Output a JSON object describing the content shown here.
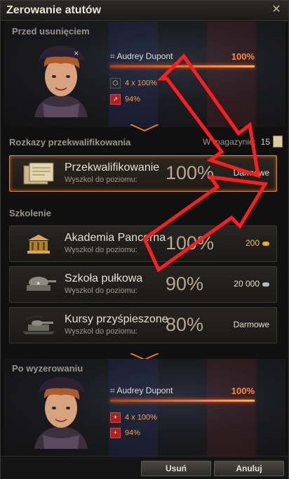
{
  "window": {
    "title": "Zerowanie atutów"
  },
  "before": {
    "label": "Przed usunięciem",
    "crew_name": "Audrey Dupont",
    "percent": "100%",
    "progress": 1.0,
    "skills": [
      {
        "icon": "perk-icon",
        "text": "4 x 100%"
      },
      {
        "icon": "perk-icon",
        "text": "94%"
      }
    ]
  },
  "orders": {
    "header": "Rozkazy przekwalifikowania",
    "storage_label": "W magazynie:",
    "storage_count": "15",
    "item": {
      "name": "Przekwalifikowanie",
      "sub": "Wyszkol do poziomu:",
      "percent": "100%",
      "price": "Darmowe"
    }
  },
  "training": {
    "header": "Szkolenie",
    "options": [
      {
        "name": "Akademia Pancerna",
        "sub": "Wyszkol do poziomu:",
        "percent": "100%",
        "price": "200",
        "currency": "gold"
      },
      {
        "name": "Szkoła pułkowa",
        "sub": "Wyszkol do poziomu:",
        "percent": "90%",
        "price": "20 000",
        "currency": "silver"
      },
      {
        "name": "Kursy przyśpieszone",
        "sub": "Wyszkol do poziomu:",
        "percent": "80%",
        "price": "Darmowe",
        "currency": "none"
      }
    ]
  },
  "after": {
    "label": "Po wyzerowaniu",
    "crew_name": "Audrey Dupont",
    "percent": "100%",
    "progress": 1.0,
    "skills": [
      {
        "icon": "perk-plus-icon",
        "text": "4 x 100%"
      },
      {
        "icon": "perk-plus-icon",
        "text": "94%"
      }
    ]
  },
  "buttons": {
    "confirm": "Usuń",
    "cancel": "Anuluj"
  },
  "colors": {
    "accent": "#ff6a20",
    "gold": "#f0c040",
    "annotation": "#ff2020"
  }
}
